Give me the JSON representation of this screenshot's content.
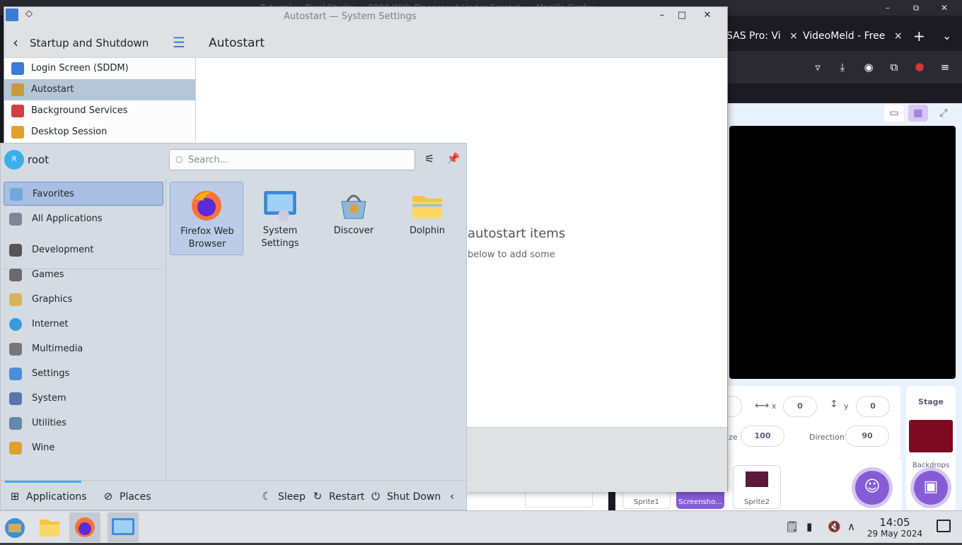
{
  "firefox": {
    "window_title": "Autostart — System Settings",
    "bg_title": "Tutorial ... Pixel Studio ... 2000 With Placement Under Scratch — Mozilla Firefox",
    "tabs": [
      {
        "label": "SAS Pro: Vi",
        "close": "×"
      },
      {
        "label": "VideoMeld - Free",
        "close": "×"
      }
    ],
    "new_tab": "+",
    "tab_list": "⌄",
    "win_buttons": {
      "minimize": "–",
      "maximize": "⧉",
      "close": "✕"
    }
  },
  "scratch": {
    "x_label": "x",
    "x_value": "0",
    "y_label": "y",
    "y_value": "0",
    "size_value": "100",
    "direction_label": "Direction",
    "direction_value": "90",
    "size_label_partial": "ize",
    "stage_label": "Stage",
    "backdrops_label": "Backdrops",
    "sprites": [
      "Sprite1",
      "Screensho...",
      "Sprite2"
    ],
    "stage_color": "#7d0a22"
  },
  "settings": {
    "title": "Autostart — System Settings",
    "sidebar_title": "Startup and Shutdown",
    "items": [
      {
        "label": "Login Screen (SDDM)",
        "color": "#3d7bd6"
      },
      {
        "label": "Autostart",
        "color": "#c99a3a"
      },
      {
        "label": "Background Services",
        "color": "#d04040"
      },
      {
        "label": "Desktop Session",
        "color": "#e0a030"
      }
    ],
    "main_title": "Autostart",
    "empty_title": "autostart items",
    "empty_hint": "below to add some",
    "win_buttons": {
      "minimize": "–",
      "maximize": "□",
      "close": "✕"
    }
  },
  "launcher": {
    "avatar_initial": "R",
    "username": "root",
    "search_placeholder": "Search...",
    "categories_top": [
      {
        "label": "Favorites",
        "selected": true
      },
      {
        "label": "All Applications",
        "selected": false
      }
    ],
    "categories": [
      {
        "label": "Development"
      },
      {
        "label": "Games"
      },
      {
        "label": "Graphics"
      },
      {
        "label": "Internet"
      },
      {
        "label": "Multimedia"
      },
      {
        "label": "Settings"
      },
      {
        "label": "System"
      },
      {
        "label": "Utilities"
      },
      {
        "label": "Wine"
      }
    ],
    "favorites": [
      {
        "line1": "Firefox Web",
        "line2": "Browser"
      },
      {
        "line1": "System",
        "line2": "Settings"
      },
      {
        "line1": "Discover",
        "line2": ""
      },
      {
        "line1": "Dolphin",
        "line2": ""
      }
    ],
    "footer": {
      "applications": "Applications",
      "places": "Places",
      "sleep": "Sleep",
      "restart": "Restart",
      "shutdown": "Shut Down"
    }
  },
  "taskbar": {
    "time": "14:05",
    "date": "29 May 2024"
  }
}
